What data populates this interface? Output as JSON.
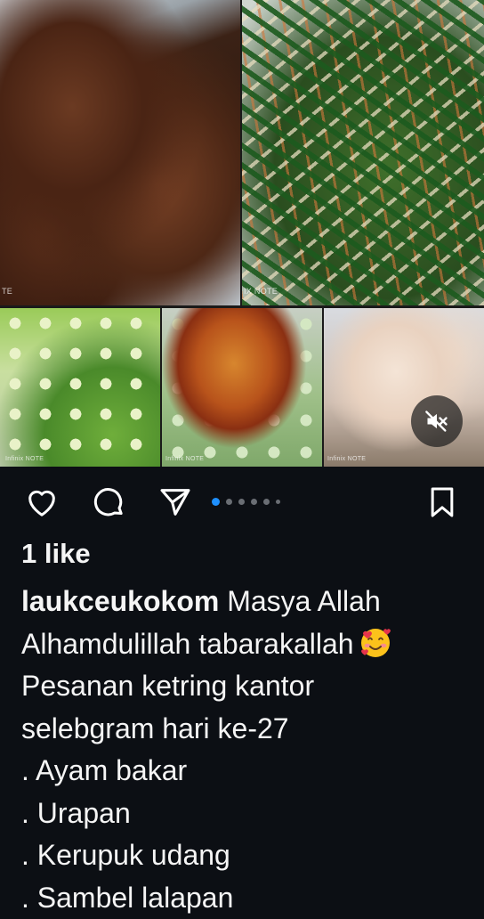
{
  "post": {
    "images": [
      {
        "name": "ayam-bakar",
        "watermark": "TE"
      },
      {
        "name": "urapan",
        "watermark": "IX NOTE"
      },
      {
        "name": "cucumber",
        "watermark": "Infinix NOTE"
      },
      {
        "name": "sambel",
        "watermark": "Infinix NOTE"
      },
      {
        "name": "kerupuk",
        "watermark": "Infinix NOTE"
      }
    ],
    "mute_icon": "speaker-muted-icon",
    "actions": {
      "like_icon": "heart-icon",
      "comment_icon": "comment-icon",
      "share_icon": "send-icon",
      "save_icon": "bookmark-icon"
    },
    "carousel": {
      "count": 6,
      "active_index": 0,
      "accent": "#1e90ff"
    },
    "likes": "1 like",
    "caption": {
      "username": "laukceukokom",
      "line1_rest": " Masya Allah",
      "line2": "Alhamdulillah tabarakallah",
      "line2_emoji": "smiling-face-with-hearts-emoji",
      "line3": "Pesanan ketring kantor",
      "line4": "selebgram hari ke-27",
      "line5": ". Ayam bakar",
      "line6": ". Urapan",
      "line7": ". Kerupuk udang",
      "line8": ". Sambel lalapan"
    }
  }
}
